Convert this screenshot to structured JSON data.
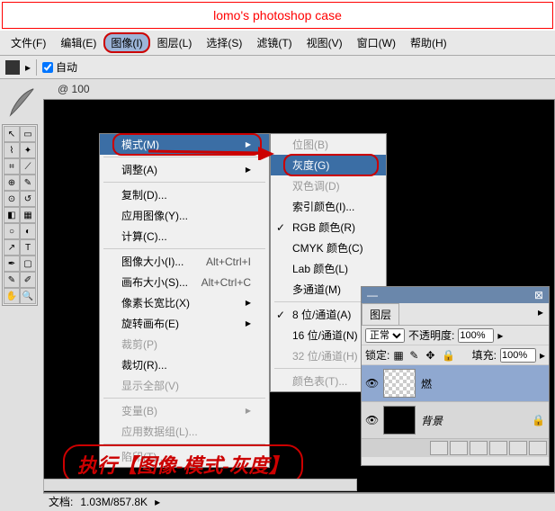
{
  "title": "lomo's photoshop case",
  "menubar": [
    "文件(F)",
    "编辑(E)",
    "图像(I)",
    "图层(L)",
    "选择(S)",
    "滤镜(T)",
    "视图(V)",
    "窗口(W)",
    "帮助(H)"
  ],
  "menubar_highlighted_index": 2,
  "options": {
    "auto": "自动"
  },
  "doc_tab": "@ 100",
  "image_menu": [
    {
      "label": "模式(M)",
      "arrow": true,
      "highlighted": true,
      "circled": true
    },
    {
      "sep": true
    },
    {
      "label": "调整(A)",
      "arrow": true
    },
    {
      "sep": true
    },
    {
      "label": "复制(D)...",
      "arrow": false
    },
    {
      "label": "应用图像(Y)...",
      "arrow": false
    },
    {
      "label": "计算(C)...",
      "arrow": false
    },
    {
      "sep": true
    },
    {
      "label": "图像大小(I)...",
      "shortcut": "Alt+Ctrl+I"
    },
    {
      "label": "画布大小(S)...",
      "shortcut": "Alt+Ctrl+C"
    },
    {
      "label": "像素长宽比(X)",
      "arrow": true
    },
    {
      "label": "旋转画布(E)",
      "arrow": true
    },
    {
      "label": "裁剪(P)",
      "disabled": true
    },
    {
      "label": "裁切(R)...",
      "arrow": false
    },
    {
      "label": "显示全部(V)",
      "disabled": true
    },
    {
      "sep": true
    },
    {
      "label": "变量(B)",
      "arrow": true,
      "disabled": true
    },
    {
      "label": "应用数据组(L)...",
      "disabled": true
    },
    {
      "sep": true
    },
    {
      "label": "陷印(T)...",
      "disabled": true
    }
  ],
  "mode_menu": [
    {
      "label": "位图(B)",
      "disabled": true
    },
    {
      "label": "灰度(G)",
      "highlighted": true,
      "circled": true
    },
    {
      "label": "双色调(D)",
      "disabled": true
    },
    {
      "label": "索引颜色(I)..."
    },
    {
      "label": "RGB 颜色(R)",
      "checked": true
    },
    {
      "label": "CMYK 颜色(C)"
    },
    {
      "label": "Lab 颜色(L)"
    },
    {
      "label": "多通道(M)"
    },
    {
      "sep": true
    },
    {
      "label": "8 位/通道(A)",
      "checked": true
    },
    {
      "label": "16 位/通道(N)"
    },
    {
      "label": "32 位/通道(H)",
      "disabled": true
    },
    {
      "sep": true
    },
    {
      "label": "颜色表(T)...",
      "disabled": true
    }
  ],
  "layers": {
    "title": "图层",
    "blend_mode": "正常",
    "opacity_label": "不透明度:",
    "opacity_value": "100%",
    "lock_label": "锁定:",
    "fill_label": "填充:",
    "fill_value": "100%",
    "items": [
      {
        "name": "燃",
        "selected": true,
        "thumb": "checker"
      },
      {
        "name": "背景",
        "selected": false,
        "thumb": "black",
        "locked": true
      }
    ]
  },
  "caption": "执行【图像-模式-灰度】",
  "status": {
    "doc_label": "文档:",
    "size": "1.03M/857.8K"
  }
}
